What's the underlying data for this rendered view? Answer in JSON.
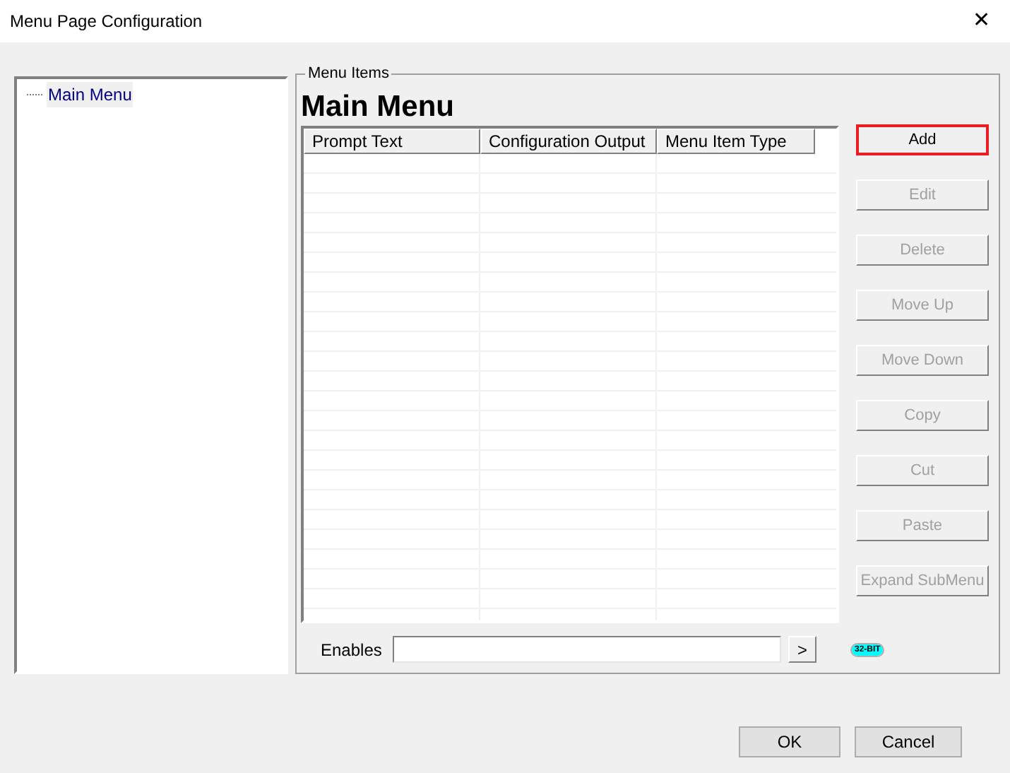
{
  "window": {
    "title": "Menu Page Configuration",
    "close": "✕"
  },
  "tree": {
    "items": [
      {
        "label": "Main Menu",
        "selected": true
      }
    ]
  },
  "group": {
    "legend": "Menu Items",
    "heading": "Main Menu"
  },
  "table": {
    "columns": [
      "Prompt Text",
      "Configuration Output",
      "Menu Item Type"
    ]
  },
  "buttons": [
    {
      "label": "Add",
      "disabled": false,
      "highlighted": true
    },
    {
      "label": "Edit",
      "disabled": true,
      "highlighted": false
    },
    {
      "label": "Delete",
      "disabled": true,
      "highlighted": false
    },
    {
      "label": "Move Up",
      "disabled": true,
      "highlighted": false
    },
    {
      "label": "Move Down",
      "disabled": true,
      "highlighted": false
    },
    {
      "label": "Copy",
      "disabled": true,
      "highlighted": false
    },
    {
      "label": "Cut",
      "disabled": true,
      "highlighted": false
    },
    {
      "label": "Paste",
      "disabled": true,
      "highlighted": false
    },
    {
      "label": "Expand SubMenu",
      "disabled": true,
      "highlighted": false
    }
  ],
  "enables": {
    "label": "Enables",
    "browse": ">"
  },
  "badge": "32-BIT",
  "footer": [
    "OK",
    "Cancel"
  ]
}
